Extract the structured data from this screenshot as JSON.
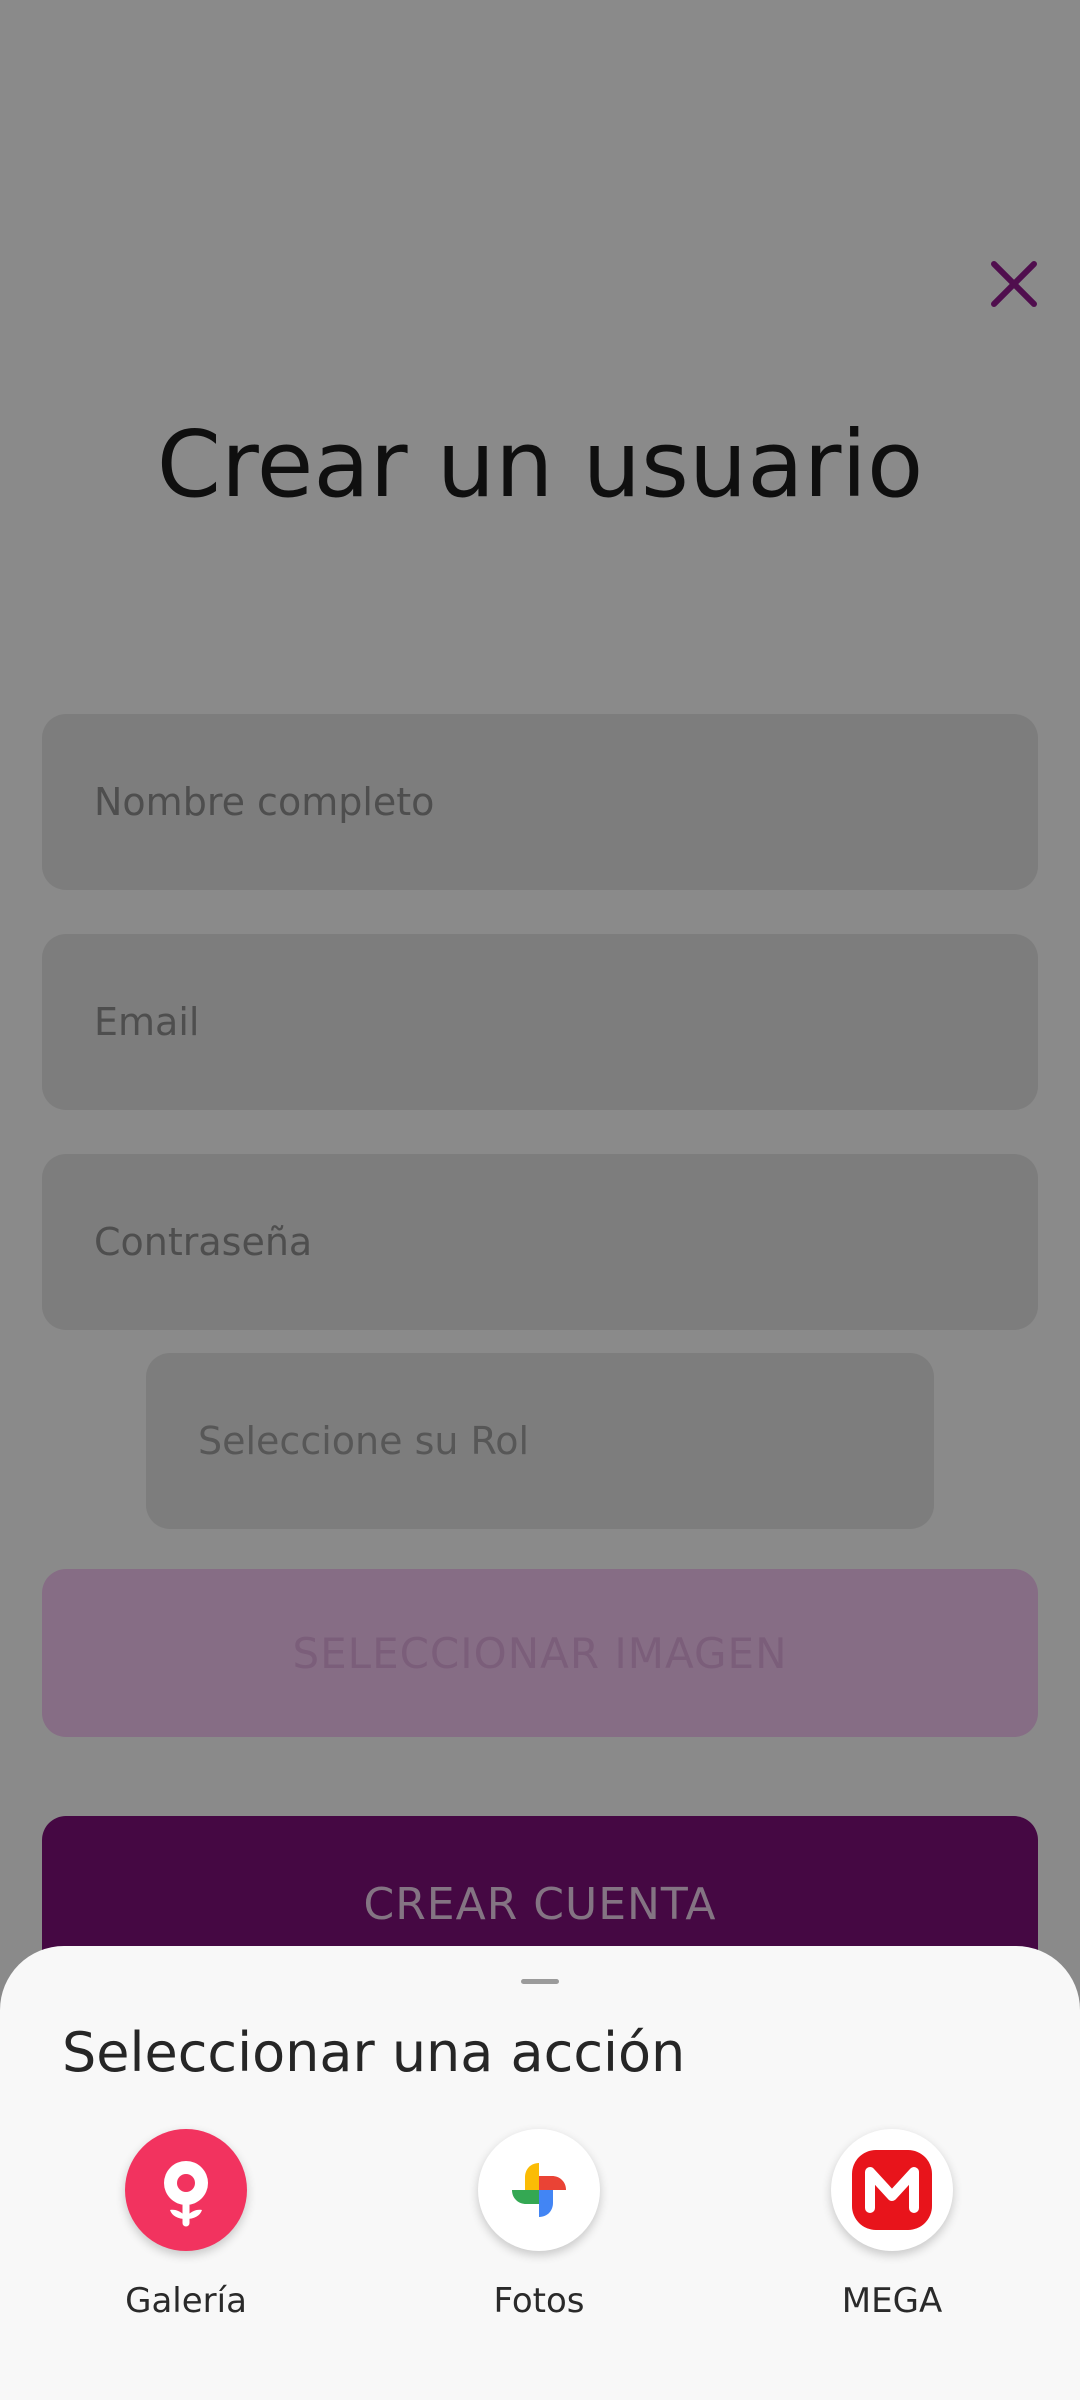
{
  "form": {
    "title": "Crear un usuario",
    "fields": {
      "full_name_placeholder": "Nombre completo",
      "email_placeholder": "Email",
      "password_placeholder": "Contraseña",
      "role_placeholder": "Seleccione su Rol"
    },
    "select_image_label": "SELECCIONAR IMAGEN",
    "create_account_label": "CREAR CUENTA"
  },
  "sheet": {
    "title": "Seleccionar una acción",
    "apps": [
      {
        "label": "Galería",
        "icon": "gallery-flower-icon"
      },
      {
        "label": "Fotos",
        "icon": "google-photos-pinwheel-icon"
      },
      {
        "label": "MEGA",
        "icon": "mega-logo-icon"
      }
    ]
  },
  "colors": {
    "primary": "#7a0f77",
    "close_icon": "#4a0a48",
    "gallery": "#f2335f",
    "mega": "#e8141b"
  }
}
